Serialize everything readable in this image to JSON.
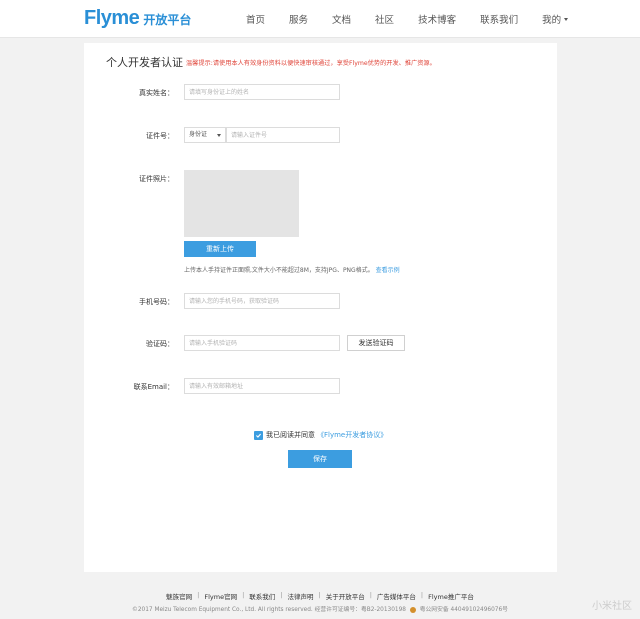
{
  "header": {
    "logo_main": "Flyme",
    "logo_sub": "开放平台",
    "nav": [
      "首页",
      "服务",
      "文档",
      "社区",
      "技术博客",
      "联系我们"
    ],
    "nav_mine": "我的"
  },
  "form": {
    "title": "个人开发者认证",
    "hint": "温馨提示:请使用本人有效身份资料以便快速审核通过，享受Flyme优势的开发、推广资源。",
    "name": {
      "label": "真实姓名：",
      "placeholder": "请填写身份证上的姓名"
    },
    "id": {
      "label": "证件号：",
      "select_value": "身份证",
      "placeholder": "请输入证件号"
    },
    "photo": {
      "label": "证件照片：",
      "reupload_label": "重新上传",
      "note": "上传本人手持证件正面照,文件大小不能超过8M，支持JPG、PNG格式。",
      "example_link": "查看示例"
    },
    "phone": {
      "label": "手机号码：",
      "placeholder": "请输入您的手机号码，获取验证码"
    },
    "code": {
      "label": "验证码：",
      "placeholder": "请输入手机验证码",
      "send_label": "发送验证码"
    },
    "email": {
      "label": "联系Email：",
      "placeholder": "请输入有效邮箱地址"
    },
    "agree": {
      "text": "我已阅读并同意",
      "link": "《Flyme开发者协议》"
    },
    "save_label": "保存"
  },
  "footer": {
    "links": [
      "魅族官网",
      "Flyme官网",
      "联系我们",
      "法律声明",
      "关于开放平台",
      "广告媒体平台",
      "Flyme推广平台"
    ],
    "copyright": "©2017 Meizu Telecom Equipment Co., Ltd. All rights reserved. 经营许可证编号：粤B2-20130198",
    "police": "粤公网安备 44049102496076号"
  },
  "watermark": "小米社区",
  "colors": {
    "accent": "#3c9de0",
    "logo": "#2a8fd6",
    "hint": "#e0453a"
  }
}
